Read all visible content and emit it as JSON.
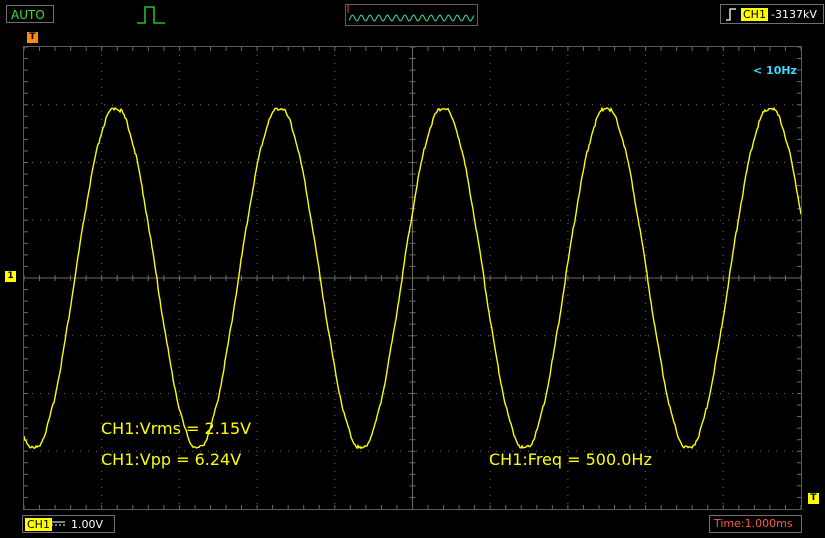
{
  "toolbar": {
    "mode_label": "AUTO",
    "trigger_channel": "CH1",
    "trigger_level": "-3137kV"
  },
  "screen": {
    "frequency_note": "< 10Hz",
    "grid": {
      "h_divs": 10,
      "v_divs": 8
    },
    "trace_color": "#ffff00",
    "grid_color": "#6a6a6a"
  },
  "waveform": {
    "shape": "sine",
    "cycles_on_screen": 4.75,
    "peak_divs": 2.95,
    "start_phase_deg": 248
  },
  "measurements": {
    "vrms": "CH1:Vrms = 2.15V",
    "vpp": "CH1:Vpp = 6.24V",
    "freq": "CH1:Freq = 500.0Hz"
  },
  "statusbar": {
    "channel": "CH1",
    "volt_scale": "1.00V",
    "time_scale": "Time:1.000ms"
  },
  "icons": {
    "pulse": "pulse-icon",
    "trigger_edge": "rising-edge-icon",
    "coupling": "dc-coupling-icon"
  }
}
